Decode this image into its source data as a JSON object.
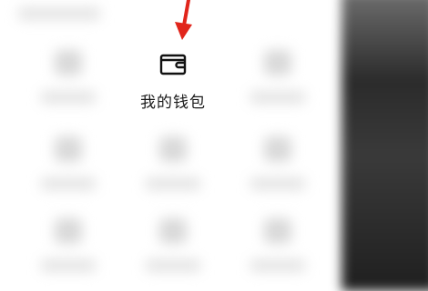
{
  "menu": {
    "wallet_item": {
      "label": "我的钱包",
      "icon": "wallet-icon"
    }
  },
  "annotation": {
    "arrow_color": "#e1251b"
  }
}
